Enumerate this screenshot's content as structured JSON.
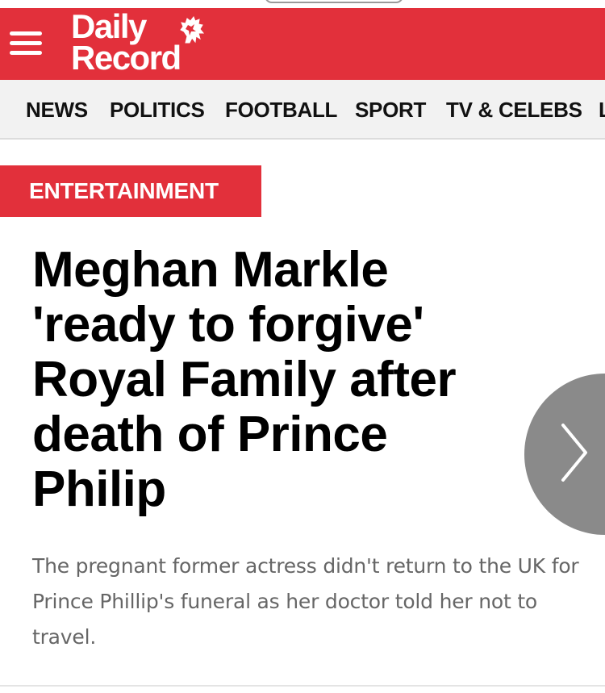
{
  "header": {
    "logo_line1": "Daily",
    "logo_line2": "Record",
    "brand_color": "#e2303b"
  },
  "nav": {
    "items": [
      {
        "label": "NEWS"
      },
      {
        "label": "POLITICS"
      },
      {
        "label": "FOOTBALL"
      },
      {
        "label": "SPORT"
      },
      {
        "label": "TV & CELEBS"
      },
      {
        "label": "L"
      }
    ]
  },
  "article": {
    "category": "ENTERTAINMENT",
    "headline": "Meghan Markle 'ready to forgive' Royal Family after death of Prince Philip",
    "standfirst": "The pregnant former actress didn't return to the UK for Prince Phillip's funeral as her doctor told her not to travel."
  },
  "icons": {
    "menu": "hamburger-menu-icon",
    "next": "chevron-right-icon",
    "logo": "lion-rampant-icon"
  }
}
